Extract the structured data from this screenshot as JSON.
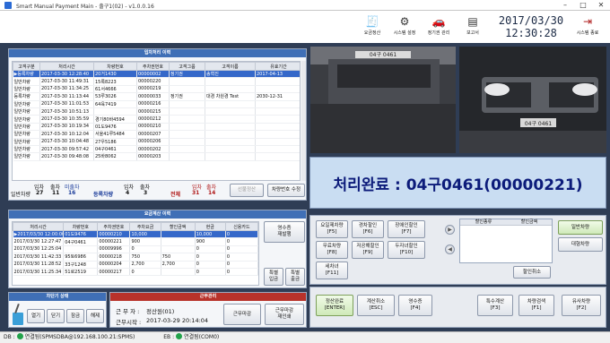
{
  "window": {
    "title": "Smart Manual Payment Main - 출구1(02) - v1.0.0.16"
  },
  "toolbar": [
    {
      "label": "요금정산",
      "icon": "receipt-icon"
    },
    {
      "label": "시스템 설정",
      "icon": "gear-icon"
    },
    {
      "label": "정기권 관리",
      "icon": "car-icon"
    },
    {
      "label": "보고서",
      "icon": "report-icon"
    },
    {
      "label": "시스템 종료",
      "icon": "exit-icon"
    }
  ],
  "clock": {
    "date": "2017/03/30",
    "time": "12:30:28"
  },
  "entry": {
    "title": "입차처리 이력",
    "columns": [
      "고객구분",
      "처리시간",
      "차량번호",
      "주차권번호",
      "고객그룹",
      "고객이름",
      "유효기간"
    ],
    "rows": [
      [
        "▶등록차량",
        "2017-03-30 12:28:40",
        "20거1430",
        "00000002",
        "정기권",
        "송혁진",
        "2017-04-13"
      ],
      [
        "일반차량",
        "2017-03-30 11:49:31",
        "15록8223",
        "00000220",
        "",
        "",
        ""
      ],
      [
        "일반차량",
        "2017-03-30 11:34:25",
        "61서4666",
        "00000219",
        "",
        "",
        ""
      ],
      [
        "등록차량",
        "2017-03-30 11:13:44",
        "53루3026",
        "00000033",
        "정기권",
        "대경 차원경 Test",
        "2030-12-31"
      ],
      [
        "일반차량",
        "2017-03-30 11:01:53",
        "64육7419",
        "00000216",
        "",
        "",
        ""
      ],
      [
        "일반차량",
        "2017-03-30 10:51:13",
        "",
        "00000215",
        "",
        "",
        ""
      ],
      [
        "일반차량",
        "2017-03-30 10:35:59",
        "경기80바4594",
        "00000212",
        "",
        "",
        ""
      ],
      [
        "일반차량",
        "2017-03-30 10:19:34",
        "01도9476",
        "00000210",
        "",
        "",
        ""
      ],
      [
        "일반차량",
        "2017-03-30 10:12:04",
        "서울41루5484",
        "00000207",
        "",
        "",
        ""
      ],
      [
        "일반차량",
        "2017-03-30 10:04:48",
        "27우5186",
        "00000206",
        "",
        "",
        ""
      ],
      [
        "일반차량",
        "2017-03-30 09:57:42",
        "04구0461",
        "00000202",
        "",
        "",
        ""
      ],
      [
        "일반차량",
        "2017-03-30 09:48:08",
        "25바8062",
        "00000203",
        "",
        "",
        ""
      ]
    ]
  },
  "entry_counts": {
    "general_label": "일반차량",
    "in_label": "입차",
    "out_label": "출차",
    "not_out_label": "미출차",
    "general_in": "27",
    "general_out": "11",
    "general_not_out": "16",
    "reg_label": "등록차량",
    "reg_in": "4",
    "reg_out": "3",
    "total_label": "전체",
    "total_in": "31",
    "total_out": "14",
    "pre_settle": "선불정산",
    "change_plate": "차량번호 수정"
  },
  "fee": {
    "title": "요금계산 이력",
    "columns": [
      "처리시간",
      "차량번호",
      "주차권번호",
      "주차요금",
      "할인금액",
      "현금",
      "신용카드"
    ],
    "rows": [
      [
        "▶2017/03/30 12:00:00",
        "01도9476",
        "00000210",
        "10,000",
        "",
        "10,000",
        "0"
      ],
      [
        "2017/03/30 12:27:47",
        "04구0461",
        "00000221",
        "900",
        "",
        "900",
        "0"
      ],
      [
        "2017/03/30 12:25:04",
        "",
        "00009996",
        "0",
        "",
        "0",
        "0"
      ],
      [
        "2017/03/30 11:42:33",
        "95토6986",
        "00000218",
        "750",
        "750",
        "0",
        "0"
      ],
      [
        "2017/03/30 11:28:52",
        "33구1248",
        "00000204",
        "2,700",
        "2,700",
        "0",
        "0"
      ],
      [
        "2017/03/30 11:25:34",
        "51로2519",
        "00000217",
        "0",
        "",
        "0",
        "0"
      ]
    ]
  },
  "fee_buttons": {
    "receipt": "영수증\n재발행",
    "special_in": "특별\n입금",
    "special_out": "특별\n출금"
  },
  "barrier": {
    "title": "차단기 상태",
    "open": "열기",
    "close": "닫기",
    "lock": "잠금",
    "unlock": "해제"
  },
  "shift": {
    "title": "근무관리",
    "worker_label": "근 무 자 :",
    "worker": "정산원(01)",
    "start_label": "근무시작 :",
    "start": "2017-03-29 20:14:04",
    "end_btn": "근무마감",
    "reissue_btn": "근무마감\n재인쇄"
  },
  "plates": {
    "left": "04구 0461",
    "right": "04구 0461"
  },
  "status": {
    "text": "처리완료 : 04구0461(00000221)"
  },
  "discounts": [
    {
      "label": "요일제차량\n[F5]"
    },
    {
      "label": "경차할인\n[F6]"
    },
    {
      "label": "장애인할인\n[F7]"
    },
    {
      "label": "무료차량\n[F8]"
    },
    {
      "label": "저공해할인\n[F9]"
    },
    {
      "label": "두자녀할인\n[F10]"
    },
    {
      "label": "세차녀\n[F11]"
    }
  ],
  "discount_list": {
    "col1": "할인종류",
    "col2": "할인금액",
    "cancel": "할인취소"
  },
  "car_type": {
    "general": "일반차량",
    "large": "대형차량"
  },
  "bottom": [
    {
      "label": "정산완료\n[ENTER]"
    },
    {
      "label": "계산취소\n[ESC]"
    },
    {
      "label": "영수증\n[F4]"
    },
    {
      "label": "특수계산\n[F3]"
    },
    {
      "label": "차량검색\n[F1]"
    },
    {
      "label": "유사차량\n[F2]"
    }
  ],
  "statusbar": {
    "db_label": "DB :",
    "db": "연결됨(SPMSDBA@192.168.100.21:SPMS)",
    "eb_label": "EB :",
    "eb": "연결됨(COM0)"
  }
}
